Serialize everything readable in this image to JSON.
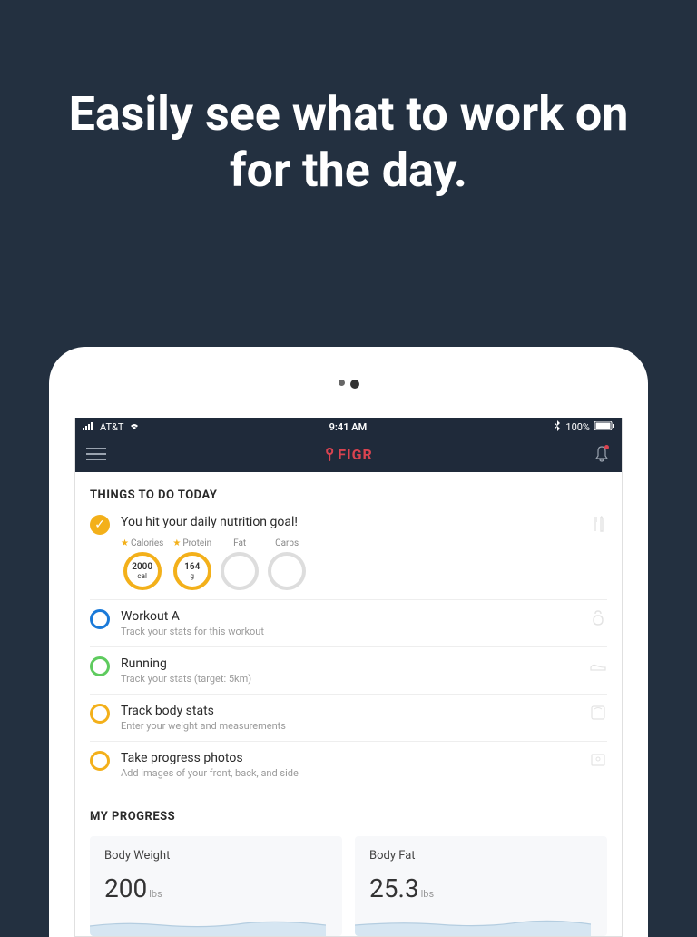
{
  "hero": "Easily see what to work on for the day.",
  "status_bar": {
    "carrier": "AT&T",
    "time": "9:41 AM",
    "battery": "100%"
  },
  "app": {
    "logo": "FIGR"
  },
  "todo": {
    "title": "THINGS TO DO TODAY",
    "nutrition": {
      "title": "You hit your daily nutrition goal!",
      "rings": [
        {
          "label": "Calories",
          "value": "2000",
          "unit": "cal",
          "filled": true,
          "starred": true
        },
        {
          "label": "Protein",
          "value": "164",
          "unit": "g",
          "filled": true,
          "starred": true
        },
        {
          "label": "Fat",
          "value": "",
          "unit": "",
          "filled": false,
          "starred": false
        },
        {
          "label": "Carbs",
          "value": "",
          "unit": "",
          "filled": false,
          "starred": false
        }
      ]
    },
    "items": [
      {
        "title": "Workout A",
        "sub": "Track your stats for this workout",
        "ring": "blue",
        "icon": "kettlebell"
      },
      {
        "title": "Running",
        "sub": "Track your stats (target: 5km)",
        "ring": "green",
        "icon": "shoe"
      },
      {
        "title": "Track body stats",
        "sub": "Enter your weight and measurements",
        "ring": "yellow",
        "icon": "scale"
      },
      {
        "title": "Take progress photos",
        "sub": "Add images of your front, back, and side",
        "ring": "yellow",
        "icon": "photo"
      }
    ]
  },
  "progress": {
    "title": "MY PROGRESS",
    "cards": [
      {
        "title": "Body Weight",
        "value": "200",
        "unit": "lbs"
      },
      {
        "title": "Body Fat",
        "value": "25.3",
        "unit": "lbs"
      }
    ]
  }
}
